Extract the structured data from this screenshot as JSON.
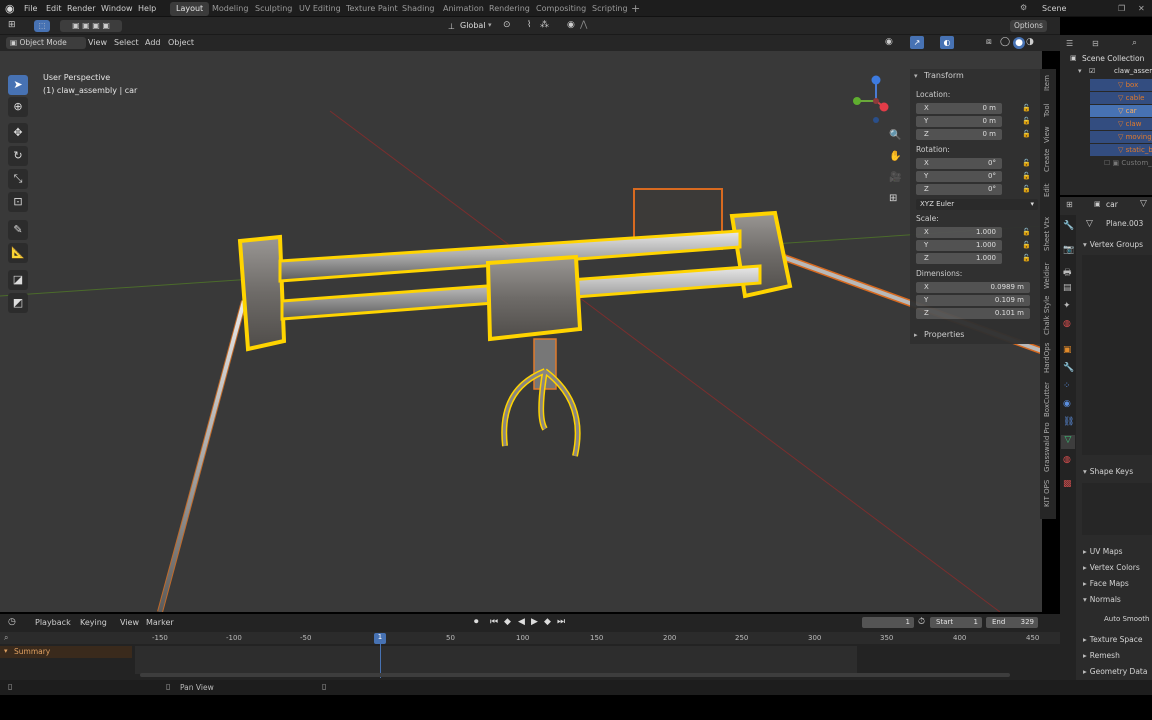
{
  "menubar": {
    "items": [
      "File",
      "Edit",
      "Render",
      "Window",
      "Help"
    ],
    "workspaces": [
      "Layout",
      "Modeling",
      "Sculpting",
      "UV Editing",
      "Texture Paint",
      "Shading",
      "Animation",
      "Rendering",
      "Compositing",
      "Scripting"
    ],
    "active_workspace": "Layout",
    "scene": "Scene"
  },
  "viewport_header": {
    "mode": "Object Mode",
    "menus": [
      "View",
      "Select",
      "Add",
      "Object"
    ],
    "transform_orientation": "Global",
    "options": "Options"
  },
  "overlay_text": {
    "perspective": "User Perspective",
    "active": "(1) claw_assembly | car"
  },
  "npanel": {
    "section": "Transform",
    "location_label": "Location:",
    "location": [
      {
        "axis": "X",
        "value": "0 m"
      },
      {
        "axis": "Y",
        "value": "0 m"
      },
      {
        "axis": "Z",
        "value": "0 m"
      }
    ],
    "rotation_label": "Rotation:",
    "rotation": [
      {
        "axis": "X",
        "value": "0°"
      },
      {
        "axis": "Y",
        "value": "0°"
      },
      {
        "axis": "Z",
        "value": "0°"
      }
    ],
    "rotation_mode": "XYZ Euler",
    "scale_label": "Scale:",
    "scale": [
      {
        "axis": "X",
        "value": "1.000"
      },
      {
        "axis": "Y",
        "value": "1.000"
      },
      {
        "axis": "Z",
        "value": "1.000"
      }
    ],
    "dimensions_label": "Dimensions:",
    "dimensions": [
      {
        "axis": "X",
        "value": "0.0989 m"
      },
      {
        "axis": "Y",
        "value": "0.109 m"
      },
      {
        "axis": "Z",
        "value": "0.101 m"
      }
    ],
    "properties": "Properties"
  },
  "vertical_tabs": [
    "Item",
    "Tool",
    "View",
    "Create",
    "Edit",
    "Sheet Vtx",
    "Weldier",
    "Chalk Style",
    "HardOps",
    "BoxCutter",
    "Grasswald Pro",
    "KIT OPS"
  ],
  "outliner": {
    "title": "Scene Collection",
    "root": "claw_assembly",
    "items": [
      {
        "name": "box",
        "selected": true
      },
      {
        "name": "cable",
        "selected": true
      },
      {
        "name": "car",
        "selected": true
      },
      {
        "name": "claw",
        "selected": true
      },
      {
        "name": "moving_bars",
        "selected": true
      },
      {
        "name": "static_bars",
        "selected": true
      },
      {
        "name": "Custom_sh",
        "selected": false
      }
    ]
  },
  "properties_panel": {
    "object": "car",
    "mesh": "Plane.003",
    "vertex_groups": "Vertex Groups",
    "shape_keys": "Shape Keys",
    "uv_maps": "UV Maps",
    "vertex_colors": "Vertex Colors",
    "face_maps": "Face Maps",
    "normals": "Normals",
    "auto_smooth": "Auto Smooth",
    "texture_space": "Texture Space",
    "remesh": "Remesh",
    "geometry_data": "Geometry Data"
  },
  "timeline": {
    "menus": [
      "Playback",
      "Keying",
      "View",
      "Marker"
    ],
    "current_frame": "1",
    "start_label": "Start",
    "start": "1",
    "end_label": "End",
    "end": "329",
    "ruler": [
      "-150",
      "-100",
      "-50",
      "1",
      "50",
      "100",
      "150",
      "200",
      "250",
      "300",
      "350",
      "400",
      "450"
    ],
    "summary": "Summary"
  },
  "statusbar": {
    "hint": "Pan View"
  },
  "colors": {
    "accent": "#4772b3",
    "selection": "#ffd400",
    "active_orange": "#e07a2c"
  }
}
